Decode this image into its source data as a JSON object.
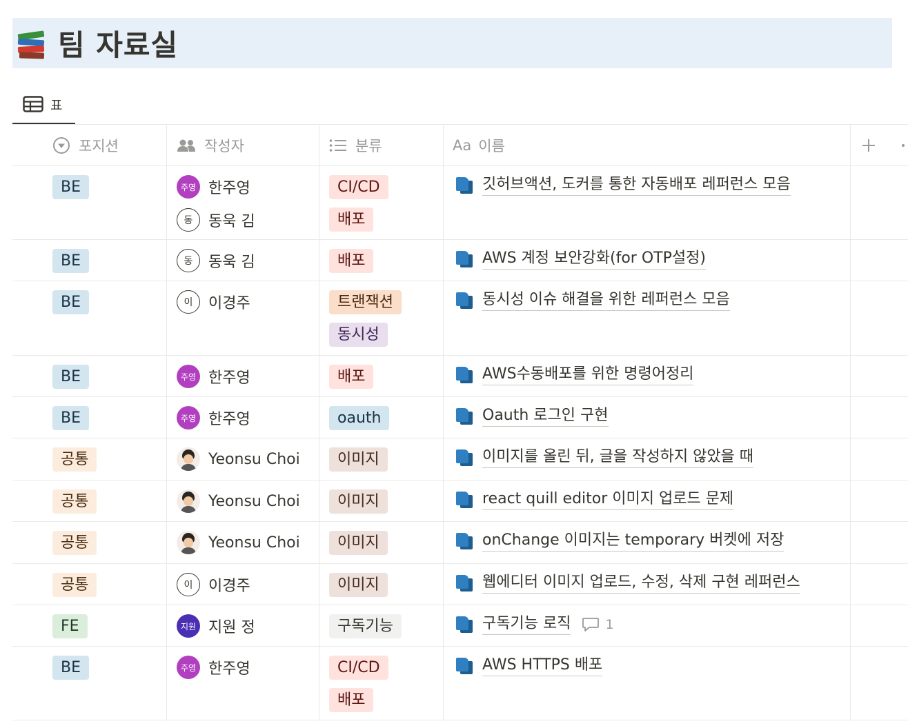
{
  "page": {
    "title": "팀 자료실",
    "icon": "books-emoji"
  },
  "view": {
    "tab_label": "표",
    "tab_icon": "table-icon"
  },
  "columns": {
    "position": {
      "label": "포지션",
      "icon": "status-select-icon"
    },
    "author": {
      "label": "작성자",
      "icon": "people-icon"
    },
    "category": {
      "label": "분류",
      "icon": "list-icon"
    },
    "name": {
      "label": "이름",
      "icon_text": "Aa"
    },
    "add": {
      "icon": "plus-icon"
    }
  },
  "colors": {
    "BE": {
      "bg": "#d3e5ef",
      "fg": "#183347"
    },
    "공통": {
      "bg": "#fbecdd",
      "fg": "#49290e"
    },
    "FE": {
      "bg": "#dbeddb",
      "fg": "#1c3829"
    },
    "CI/CD": {
      "bg": "#ffe2dd",
      "fg": "#5d1715"
    },
    "배포": {
      "bg": "#ffe2dd",
      "fg": "#5d1715"
    },
    "트랜잭션": {
      "bg": "#fadec9",
      "fg": "#49290e"
    },
    "동시성": {
      "bg": "#e8deee",
      "fg": "#412454"
    },
    "oauth": {
      "bg": "#d3e5ef",
      "fg": "#183347"
    },
    "이미지": {
      "bg": "#eee0da",
      "fg": "#442a1e"
    },
    "구독기능": {
      "bg": "#f1f1ef",
      "fg": "#37352f"
    }
  },
  "rows": [
    {
      "position": "BE",
      "authors": [
        {
          "name": "한주영",
          "avatar": "주영",
          "color": "#b13fc0"
        },
        {
          "name": "동욱 김",
          "avatar": "동",
          "color": "outline"
        }
      ],
      "categories": [
        "CI/CD",
        "배포"
      ],
      "title": "깃허브액션, 도커를 통한 자동배포 레퍼런스 모음"
    },
    {
      "position": "BE",
      "authors": [
        {
          "name": "동욱 김",
          "avatar": "동",
          "color": "outline"
        }
      ],
      "categories": [
        "배포"
      ],
      "title": "AWS 계정 보안강화(for OTP설정)"
    },
    {
      "position": "BE",
      "authors": [
        {
          "name": "이경주",
          "avatar": "이",
          "color": "outline"
        }
      ],
      "categories": [
        "트랜잭션",
        "동시성"
      ],
      "title": "동시성 이슈 해결을 위한 레퍼런스 모음"
    },
    {
      "position": "BE",
      "authors": [
        {
          "name": "한주영",
          "avatar": "주영",
          "color": "#b13fc0"
        }
      ],
      "categories": [
        "배포"
      ],
      "title": "AWS수동배포를 위한 명령어정리"
    },
    {
      "position": "BE",
      "authors": [
        {
          "name": "한주영",
          "avatar": "주영",
          "color": "#b13fc0"
        }
      ],
      "categories": [
        "oauth"
      ],
      "title": "Oauth 로그인 구현"
    },
    {
      "position": "공통",
      "authors": [
        {
          "name": "Yeonsu Choi",
          "avatar": "",
          "color": "photo"
        }
      ],
      "categories": [
        "이미지"
      ],
      "title": "이미지를 올린 뒤, 글을 작성하지 않았을 때"
    },
    {
      "position": "공통",
      "authors": [
        {
          "name": "Yeonsu Choi",
          "avatar": "",
          "color": "photo"
        }
      ],
      "categories": [
        "이미지"
      ],
      "title": "react quill editor 이미지 업로드 문제"
    },
    {
      "position": "공통",
      "authors": [
        {
          "name": "Yeonsu Choi",
          "avatar": "",
          "color": "photo"
        }
      ],
      "categories": [
        "이미지"
      ],
      "title": "onChange 이미지는 temporary 버켓에 저장"
    },
    {
      "position": "공통",
      "authors": [
        {
          "name": "이경주",
          "avatar": "이",
          "color": "outline"
        }
      ],
      "categories": [
        "이미지"
      ],
      "title": "웹에디터 이미지 업로드, 수정, 삭제 구현 레퍼런스"
    },
    {
      "position": "FE",
      "authors": [
        {
          "name": "지원 정",
          "avatar": "지원",
          "color": "#4a2fb3"
        }
      ],
      "categories": [
        "구독기능"
      ],
      "title": "구독기능 로직",
      "comments": "1"
    },
    {
      "position": "BE",
      "authors": [
        {
          "name": "한주영",
          "avatar": "주영",
          "color": "#b13fc0"
        }
      ],
      "categories": [
        "CI/CD",
        "배포"
      ],
      "title": "AWS HTTPS 배포"
    }
  ]
}
